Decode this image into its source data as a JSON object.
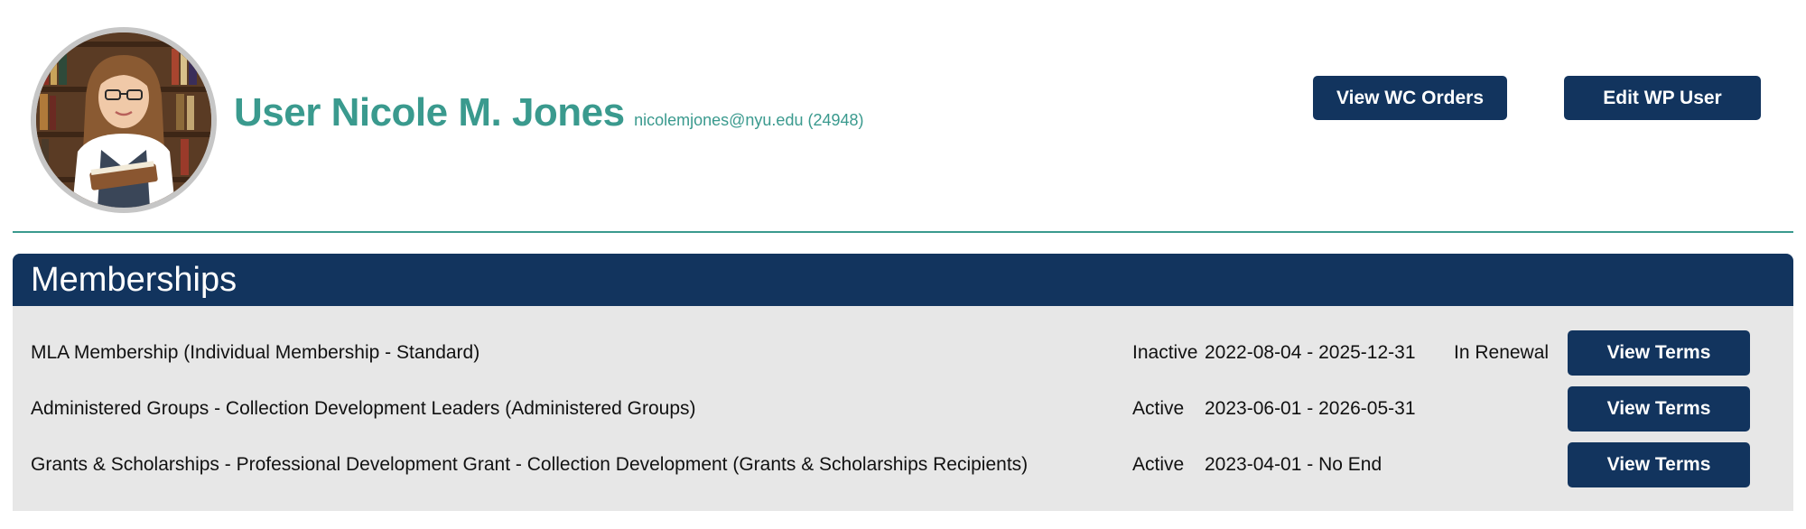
{
  "header": {
    "title_prefix": "User",
    "name": "Nicole M. Jones",
    "email_id": "nicolemjones@nyu.edu (24948)",
    "buttons": {
      "view_wc_orders": "View WC Orders",
      "edit_wp_user": "Edit WP User"
    }
  },
  "memberships": {
    "title": "Memberships",
    "rows": [
      {
        "name": "MLA Membership (Individual Membership - Standard)",
        "status": "Inactive",
        "dates": "2022-08-04 - 2025-12-31",
        "note": "In Renewal",
        "button": "View Terms"
      },
      {
        "name": "Administered Groups - Collection Development Leaders (Administered Groups)",
        "status": "Active",
        "dates": "2023-06-01 - 2026-05-31",
        "note": "",
        "button": "View Terms"
      },
      {
        "name": "Grants & Scholarships - Professional Development Grant - Collection Development (Grants & Scholarships Recipients)",
        "status": "Active",
        "dates": "2023-04-01 - No End",
        "note": "",
        "button": "View Terms"
      }
    ]
  },
  "colors": {
    "accent_teal": "#3a9a8e",
    "navy": "#12345e",
    "panel_gray": "#e7e7e7"
  }
}
